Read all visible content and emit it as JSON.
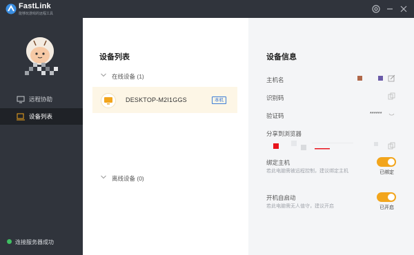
{
  "app": {
    "brand": "FastLink",
    "slogan": "能够玩游戏的远程工具"
  },
  "titlebar": {
    "settings_icon": "settings-icon",
    "minimize_icon": "minimize-icon",
    "close_icon": "close-icon"
  },
  "sidebar": {
    "items": [
      {
        "label": "远程协助",
        "icon": "remote-assist-icon",
        "active": false
      },
      {
        "label": "设备列表",
        "icon": "device-list-icon",
        "active": true
      }
    ],
    "status": "连接服务器成功"
  },
  "device_list": {
    "title": "设备列表",
    "online_group": "在线设备 (1)",
    "offline_group": "离线设备 (0)",
    "devices": [
      {
        "name": "DESKTOP-M2I1GGS",
        "badge": "本机"
      }
    ]
  },
  "device_info": {
    "title": "设备信息",
    "hostname_label": "主机名",
    "id_label": "识别码",
    "verify_label": "验证码",
    "verify_value": "******",
    "share_label": "分享到浏览器",
    "bind_label": "绑定主机",
    "bind_desc": "若此电脑需被远程控制，建议绑定主机",
    "bind_state": "已绑定",
    "autostart_label": "开机自启动",
    "autostart_desc": "若此电脑需无人值守，建议开启",
    "autostart_state": "已开启"
  },
  "colors": {
    "sidebar": "#30343c",
    "accent": "#f2a51c",
    "badge": "#3a7bd5",
    "status_ok": "#3fbf62"
  }
}
